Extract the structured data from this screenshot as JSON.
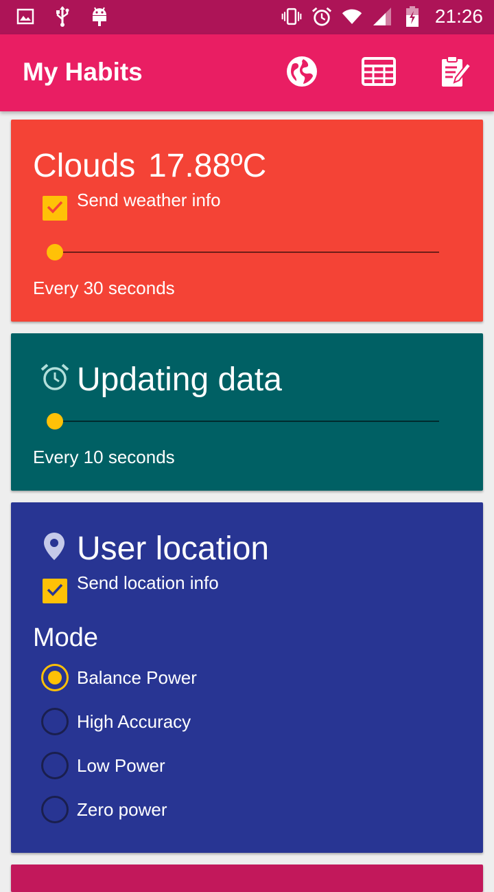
{
  "status_bar": {
    "time": "21:26",
    "left_icons": [
      "image-icon",
      "usb-icon",
      "android-icon"
    ],
    "right_icons": [
      "vibrate-icon",
      "alarm-icon",
      "wifi-icon",
      "signal-icon",
      "battery-icon"
    ]
  },
  "app_bar": {
    "title": "My Habits",
    "actions": [
      "globe-icon",
      "grid-icon",
      "clipboard-edit-icon"
    ]
  },
  "weather_card": {
    "condition": "Clouds",
    "temperature": "17.88ºC",
    "checkbox_label": "Send weather info",
    "checked": true,
    "slider_value": 0,
    "interval_text": "Every 30 seconds",
    "color": "#f44336"
  },
  "update_card": {
    "title": "Updating data",
    "icon": "alarm-icon",
    "slider_value": 0,
    "interval_text": "Every 10 seconds",
    "color": "#006064"
  },
  "location_card": {
    "title": "User location",
    "icon": "location-pin-icon",
    "checkbox_label": "Send location info",
    "checked": true,
    "mode_label": "Mode",
    "modes": [
      {
        "label": "Balance Power",
        "selected": true
      },
      {
        "label": "High Accuracy",
        "selected": false
      },
      {
        "label": "Low Power",
        "selected": false
      },
      {
        "label": "Zero power",
        "selected": false
      }
    ],
    "color": "#283593"
  },
  "colors": {
    "status_bar": "#ad1457",
    "app_bar": "#e91e63",
    "accent": "#ffc107",
    "next_card": "#c2185b"
  }
}
